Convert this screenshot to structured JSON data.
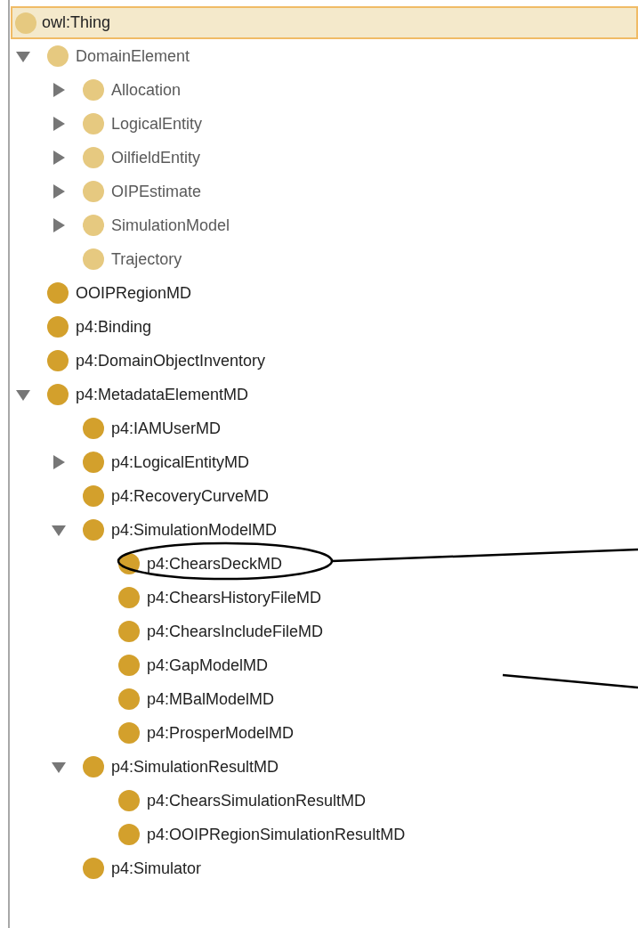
{
  "root": {
    "label": "owl:Thing",
    "selected": true,
    "dimmed": true
  },
  "items": [
    {
      "label": "DomainElement",
      "expanded": true,
      "dimmed": true,
      "selected": false,
      "children": [
        {
          "label": "Allocation",
          "expanded": false,
          "dimmed": true,
          "selected": false
        },
        {
          "label": "LogicalEntity",
          "expanded": false,
          "dimmed": true,
          "selected": false
        },
        {
          "label": "OilfieldEntity",
          "expanded": false,
          "dimmed": true,
          "selected": false
        },
        {
          "label": "OIPEstimate",
          "expanded": false,
          "dimmed": true,
          "selected": false
        },
        {
          "label": "SimulationModel",
          "expanded": false,
          "dimmed": true,
          "selected": false
        },
        {
          "label": "Trajectory",
          "dimmed": true,
          "selected": false
        }
      ]
    },
    {
      "label": "OOIPRegionMD",
      "dimmed": false,
      "selected": false
    },
    {
      "label": "p4:Binding",
      "dimmed": false,
      "selected": false
    },
    {
      "label": "p4:DomainObjectInventory",
      "dimmed": false,
      "selected": false
    },
    {
      "label": "p4:MetadataElementMD",
      "expanded": true,
      "dimmed": false,
      "selected": false,
      "children": [
        {
          "label": "p4:IAMUserMD",
          "dimmed": false,
          "selected": false
        },
        {
          "label": "p4:LogicalEntityMD",
          "expanded": false,
          "dimmed": false,
          "selected": false
        },
        {
          "label": "p4:RecoveryCurveMD",
          "dimmed": false,
          "selected": false
        },
        {
          "label": "p4:SimulationModelMD",
          "expanded": true,
          "dimmed": false,
          "selected": false,
          "children": [
            {
              "label": "p4:ChearsDeckMD",
              "dimmed": false,
              "selected": false
            },
            {
              "label": "p4:ChearsHistoryFileMD",
              "dimmed": false,
              "selected": false
            },
            {
              "label": "p4:ChearsIncludeFileMD",
              "dimmed": false,
              "selected": false
            },
            {
              "label": "p4:GapModelMD",
              "dimmed": false,
              "selected": false
            },
            {
              "label": "p4:MBalModelMD",
              "dimmed": false,
              "selected": false
            },
            {
              "label": "p4:ProsperModelMD",
              "dimmed": false,
              "selected": false
            }
          ]
        },
        {
          "label": "p4:SimulationResultMD",
          "expanded": true,
          "dimmed": false,
          "selected": false,
          "children": [
            {
              "label": "p4:ChearsSimulationResultMD",
              "dimmed": false,
              "selected": false
            },
            {
              "label": "p4:OOIPRegionSimulationResultMD",
              "dimmed": false,
              "selected": false
            }
          ]
        },
        {
          "label": "p4:Simulator",
          "dimmed": false,
          "selected": false
        }
      ]
    }
  ]
}
